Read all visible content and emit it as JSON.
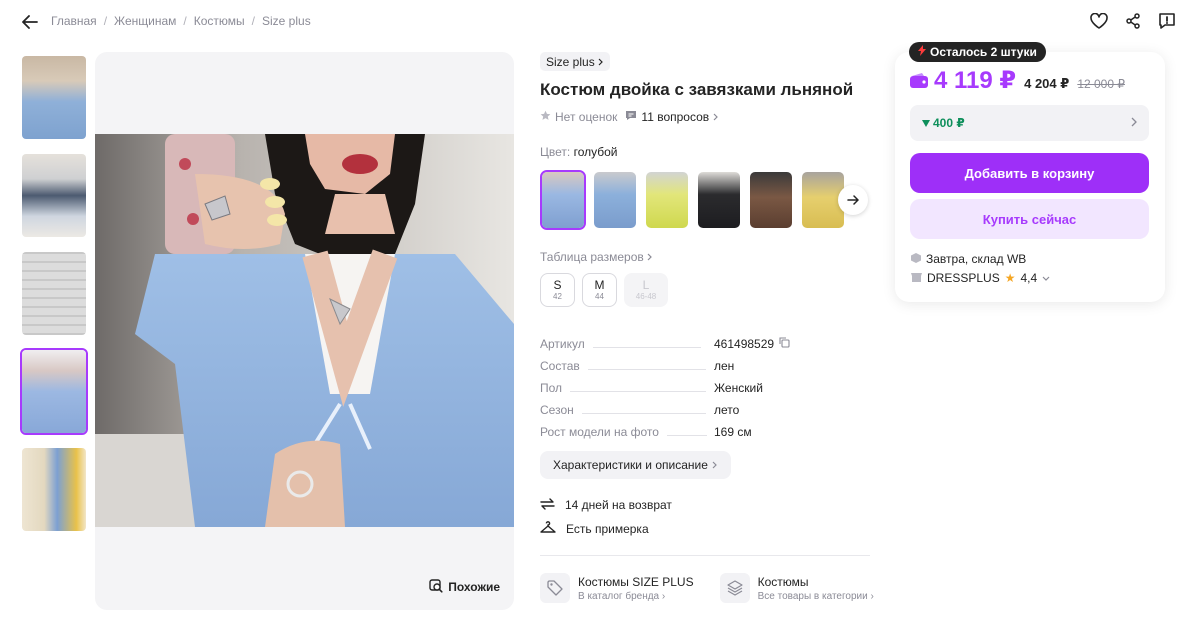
{
  "breadcrumb": [
    "Главная",
    "Женщинам",
    "Костюмы",
    "Size plus"
  ],
  "similar_label": "Похожие",
  "product": {
    "brand_chip": "Size plus",
    "title": "Костюм двойка с завязками льняной",
    "rating_text": "Нет оценок",
    "questions_text": "11 вопросов",
    "color_prefix": "Цвет:",
    "color_value": "голубой",
    "size_table_label": "Таблица размеров",
    "sizes": [
      {
        "label": "S",
        "sub": "42",
        "available": true
      },
      {
        "label": "M",
        "sub": "44",
        "available": true
      },
      {
        "label": "L",
        "sub": "46-48",
        "available": false
      }
    ],
    "params": [
      {
        "key": "Артикул",
        "value": "461498529"
      },
      {
        "key": "Состав",
        "value": "лен"
      },
      {
        "key": "Пол",
        "value": "Женский"
      },
      {
        "key": "Сезон",
        "value": "лето"
      },
      {
        "key": "Рост модели на фото",
        "value": "169 см"
      }
    ],
    "characteristics_button": "Характеристики и описание",
    "features": [
      "14 дней на возврат",
      "Есть примерка"
    ],
    "links": [
      {
        "title": "Костюмы SIZE PLUS",
        "sub": "В каталог бренда"
      },
      {
        "title": "Костюмы",
        "sub": "Все товары в категории"
      }
    ]
  },
  "buy": {
    "stock_badge": "Осталось 2 штуки",
    "price_main": "4 119 ₽",
    "price_mid": "4 204 ₽",
    "price_old": "12 000 ₽",
    "discount": "400 ₽",
    "add_to_cart": "Добавить в корзину",
    "buy_now": "Купить сейчас",
    "delivery": "Завтра, склад WB",
    "seller": "DRESSPLUS",
    "seller_rating": "4,4"
  },
  "colors": {
    "accent": "#a73afd",
    "button": "#9e2ff8",
    "discount_green": "#0e8f5b"
  }
}
